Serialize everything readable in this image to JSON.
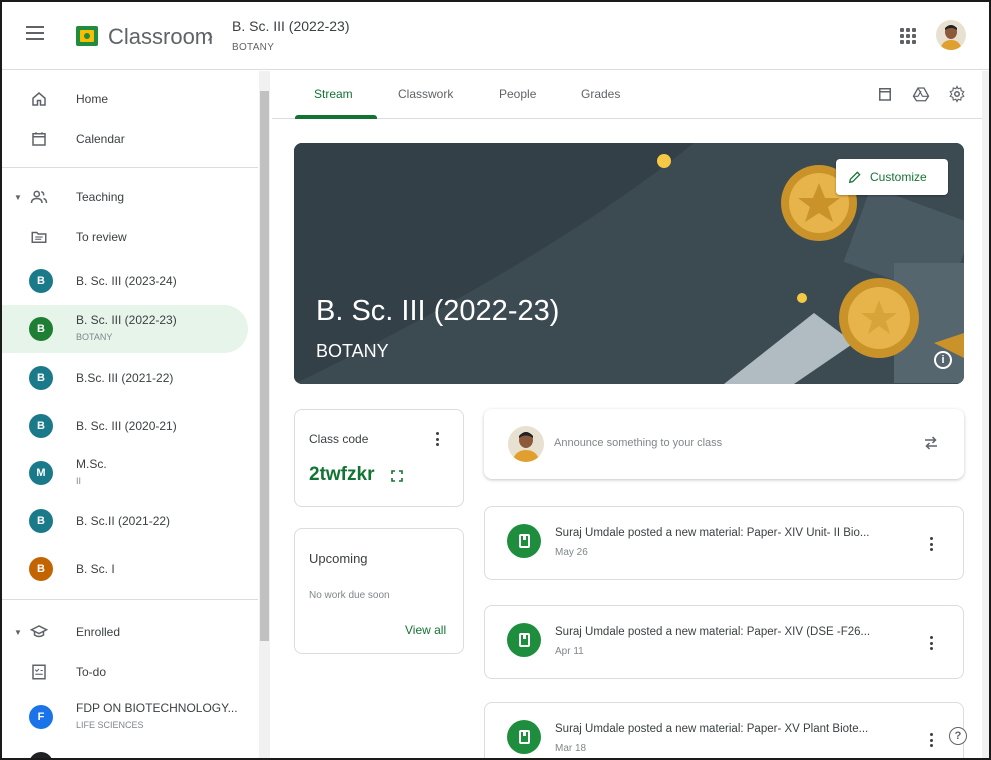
{
  "header": {
    "app_title": "Classroom",
    "crumb_separator": "›",
    "class_title": "B. Sc. III (2022-23)",
    "class_subtitle": "BOTANY"
  },
  "sidebar": {
    "home": "Home",
    "calendar": "Calendar",
    "teaching": "Teaching",
    "to_review": "To review",
    "classes": [
      {
        "initial": "B",
        "name": "B. Sc. III (2023-24)",
        "sub": "",
        "color": "#1a7a8a"
      },
      {
        "initial": "B",
        "name": "B. Sc. III (2022-23)",
        "sub": "BOTANY",
        "color": "#1e7e34"
      },
      {
        "initial": "B",
        "name": "B.Sc. III (2021-22)",
        "sub": "",
        "color": "#1a7a8a"
      },
      {
        "initial": "B",
        "name": "B. Sc. III (2020-21)",
        "sub": "",
        "color": "#1a7a8a"
      },
      {
        "initial": "M",
        "name": "M.Sc.",
        "sub": "II",
        "color": "#1a7a8a"
      },
      {
        "initial": "B",
        "name": "B. Sc.II (2021-22)",
        "sub": "",
        "color": "#1a7a8a"
      },
      {
        "initial": "B",
        "name": "B. Sc. I",
        "sub": "",
        "color": "#c26401"
      }
    ],
    "enrolled": "Enrolled",
    "todo": "To-do",
    "enrolled_class": {
      "initial": "F",
      "name": "FDP ON BIOTECHNOLOGY...",
      "sub": "LIFE SCIENCES",
      "color": "#1a73e8"
    }
  },
  "tabs": [
    "Stream",
    "Classwork",
    "People",
    "Grades"
  ],
  "banner": {
    "title": "B. Sc. III (2022-23)",
    "subtitle": "BOTANY",
    "customize": "Customize"
  },
  "class_code": {
    "label": "Class code",
    "value": "2twfzkr"
  },
  "upcoming": {
    "title": "Upcoming",
    "empty": "No work due soon",
    "view_all": "View all"
  },
  "announce": {
    "placeholder": "Announce something to your class"
  },
  "posts": [
    {
      "title": "Suraj Umdale posted a new material: Paper- XIV Unit- II Bio...",
      "date": "May 26"
    },
    {
      "title": "Suraj Umdale posted a new material: Paper- XIV (DSE -F26...",
      "date": "Apr 11"
    },
    {
      "title": "Suraj Umdale posted a new material: Paper- XV Plant Biote...",
      "date": "Mar 18"
    }
  ],
  "colors": {
    "accent": "#137333",
    "banner": "#37474f",
    "active_nav": "#e6f4ea"
  }
}
